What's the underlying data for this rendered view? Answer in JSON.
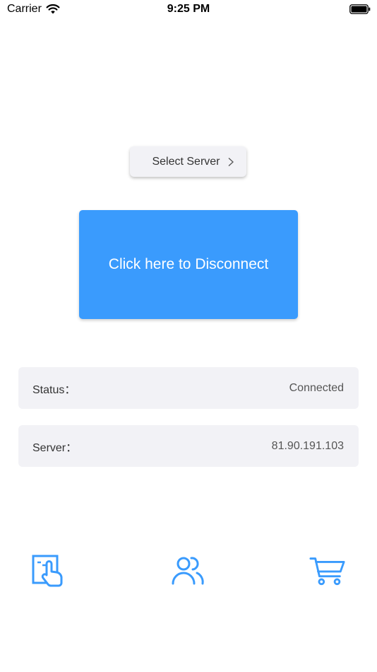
{
  "status_bar": {
    "carrier": "Carrier",
    "time": "9:25 PM"
  },
  "server_selector": {
    "label": "Select Server"
  },
  "main_button": {
    "label": "Click here to Disconnect"
  },
  "info": {
    "status_label": "Status：",
    "status_value": "Connected",
    "server_label": "Server：",
    "server_value": "81.90.191.103"
  },
  "tab_bar": {
    "items": [
      {
        "icon": "touch-screen-icon"
      },
      {
        "icon": "users-icon"
      },
      {
        "icon": "cart-icon"
      }
    ]
  },
  "colors": {
    "accent": "#3a9bfd",
    "row_bg": "#f2f2f6"
  }
}
